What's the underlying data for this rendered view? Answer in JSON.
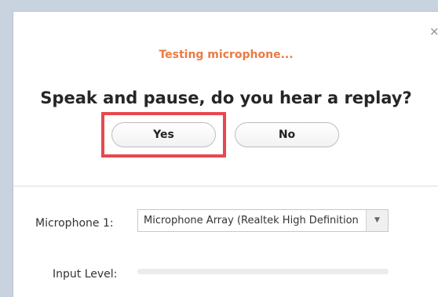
{
  "dialog": {
    "close_glyph": "×",
    "status_text": "Testing microphone...",
    "question": "Speak and pause, do you hear a replay?",
    "yes_label": "Yes",
    "no_label": "No"
  },
  "settings": {
    "microphone_label": "Microphone 1:",
    "microphone_value": "Microphone Array (Realtek High Definition",
    "input_level_label": "Input Level:",
    "input_level": 0
  },
  "colors": {
    "status_accent": "#ec7a43",
    "highlight": "#e8474f"
  },
  "icons": {
    "close": "close-icon",
    "dropdown": "chevron-down-icon"
  }
}
